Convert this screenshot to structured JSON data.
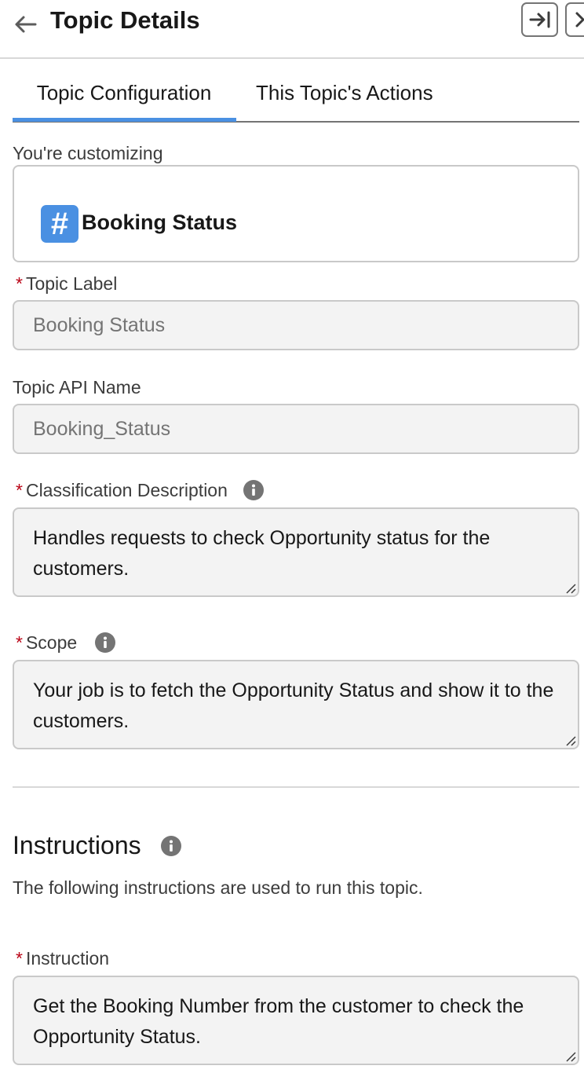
{
  "header": {
    "title": "Topic Details",
    "back_icon": "arrow-left-icon",
    "dock_icon": "arrow-to-right-icon",
    "next_icon": "chevron-right-icon"
  },
  "tabs": [
    {
      "label": "Topic Configuration",
      "active": true
    },
    {
      "label": "This Topic's Actions",
      "active": false
    }
  ],
  "customizing": {
    "label": "You're customizing",
    "topic_icon": "hash-icon",
    "topic_name": "Booking Status"
  },
  "fields": {
    "topic_label": {
      "label": "Topic Label",
      "value": "Booking Status",
      "required": true
    },
    "api_name": {
      "label": "Topic API Name",
      "value": "Booking_Status",
      "required": false
    },
    "classification": {
      "label": "Classification Description",
      "value": "Handles requests to check Opportunity status for the customers.",
      "required": true
    },
    "scope": {
      "label": "Scope",
      "value": "Your job is to fetch the Opportunity Status and show it to the customers.",
      "required": true
    }
  },
  "instructions": {
    "title": "Instructions",
    "description": "The following instructions are used to run this topic.",
    "instruction": {
      "label": "Instruction",
      "value": "Get the Booking Number from the customer to check the Opportunity Status.",
      "required": true
    }
  },
  "required_marker": "*",
  "colors": {
    "accent": "#4a90e2",
    "required": "#ba0517",
    "field_bg": "#f3f3f3",
    "border": "#c9c9c9"
  }
}
